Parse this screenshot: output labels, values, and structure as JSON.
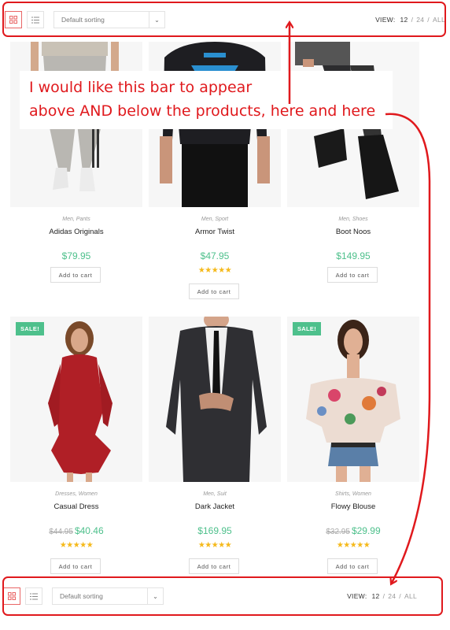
{
  "toolbar": {
    "sort_label": "Default sorting",
    "view_label": "VIEW:",
    "view_current": "12",
    "view_options": [
      "24",
      "ALL"
    ],
    "separator": "/"
  },
  "annotation": {
    "line1": "I would like this bar to appear",
    "line2": "above AND below the products, here and here",
    "color": "#e0191d"
  },
  "products": [
    {
      "category": "Men, Pants",
      "name": "Adidas Originals",
      "price": "$79.95",
      "rating_stars": 0,
      "cart_label": "Add to cart"
    },
    {
      "category": "Men, Sport",
      "name": "Armor Twist",
      "price": "$47.95",
      "rating_stars": 5,
      "cart_label": "Add to cart"
    },
    {
      "category": "Men, Shoes",
      "name": "Boot Noos",
      "price": "$149.95",
      "rating_stars": 0,
      "cart_label": "Add to cart"
    },
    {
      "category": "Dresses, Women",
      "name": "Casual Dress",
      "old_price": "$44.95",
      "price": "$40.46",
      "sale_label": "SALE!",
      "rating_stars": 5,
      "cart_label": "Add to cart"
    },
    {
      "category": "Men, Suit",
      "name": "Dark Jacket",
      "price": "$169.95",
      "rating_stars": 5,
      "cart_label": "Add to cart"
    },
    {
      "category": "Shirts, Women",
      "name": "Flowy Blouse",
      "old_price": "$32.95",
      "price": "$29.99",
      "sale_label": "SALE!",
      "rating_stars": 5,
      "cart_label": "Add to cart"
    }
  ],
  "colors": {
    "price": "#4ec08c",
    "sale_badge": "#4ec08c",
    "star": "#f5b91a",
    "active_view": "#e96666"
  }
}
